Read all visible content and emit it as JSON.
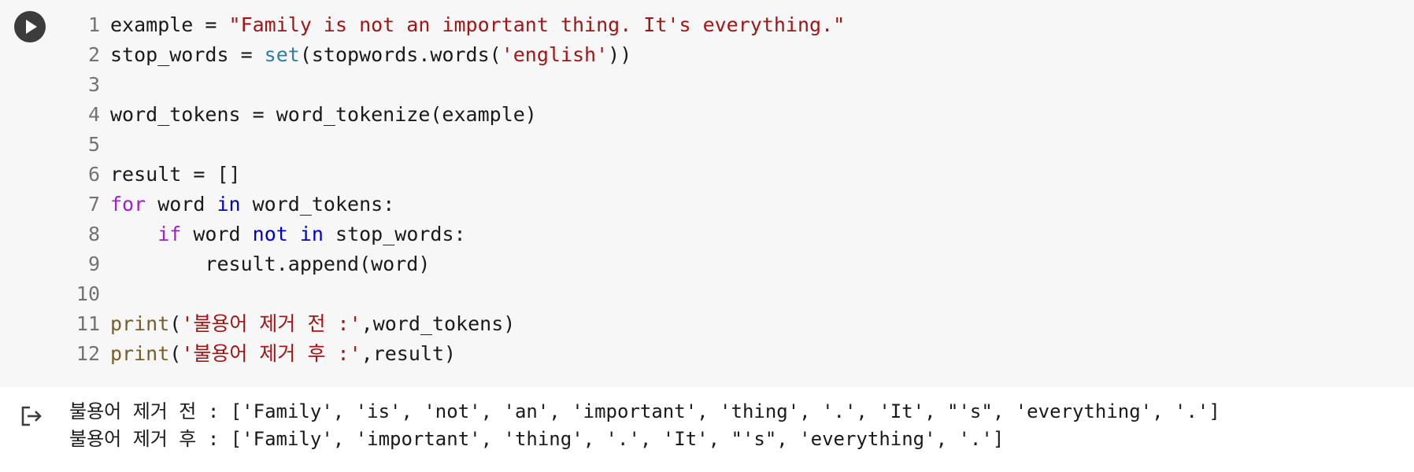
{
  "cell": {
    "run_icon": "play-icon",
    "output_icon": "output-redirect-icon",
    "lines": [
      {
        "n": "1",
        "tokens": [
          {
            "t": "example = ",
            "c": "plain"
          },
          {
            "t": "\"Family is not an important thing. It's everything.\"",
            "c": "str"
          }
        ]
      },
      {
        "n": "2",
        "tokens": [
          {
            "t": "stop_words = ",
            "c": "plain"
          },
          {
            "t": "set",
            "c": "bi"
          },
          {
            "t": "(stopwords.words(",
            "c": "plain"
          },
          {
            "t": "'english'",
            "c": "str"
          },
          {
            "t": "))",
            "c": "plain"
          }
        ]
      },
      {
        "n": "3",
        "tokens": []
      },
      {
        "n": "4",
        "tokens": [
          {
            "t": "word_tokens = word_tokenize(example)",
            "c": "plain"
          }
        ]
      },
      {
        "n": "5",
        "tokens": []
      },
      {
        "n": "6",
        "tokens": [
          {
            "t": "result = []",
            "c": "plain"
          }
        ]
      },
      {
        "n": "7",
        "tokens": [
          {
            "t": "for",
            "c": "kw"
          },
          {
            "t": " word ",
            "c": "plain"
          },
          {
            "t": "in",
            "c": "op"
          },
          {
            "t": " word_tokens:",
            "c": "plain"
          }
        ]
      },
      {
        "n": "8",
        "tokens": [
          {
            "t": "    ",
            "c": "plain"
          },
          {
            "t": "if",
            "c": "kw"
          },
          {
            "t": " word ",
            "c": "plain"
          },
          {
            "t": "not",
            "c": "op"
          },
          {
            "t": " ",
            "c": "plain"
          },
          {
            "t": "in",
            "c": "op"
          },
          {
            "t": " stop_words:",
            "c": "plain"
          }
        ]
      },
      {
        "n": "9",
        "tokens": [
          {
            "t": "        result.append(word)",
            "c": "plain"
          }
        ]
      },
      {
        "n": "10",
        "tokens": []
      },
      {
        "n": "11",
        "tokens": [
          {
            "t": "print",
            "c": "fn"
          },
          {
            "t": "(",
            "c": "plain"
          },
          {
            "t": "'불용어 제거 전 :'",
            "c": "str"
          },
          {
            "t": ",word_tokens)",
            "c": "plain"
          }
        ]
      },
      {
        "n": "12",
        "tokens": [
          {
            "t": "print",
            "c": "fn"
          },
          {
            "t": "(",
            "c": "plain"
          },
          {
            "t": "'불용어 제거 후 :'",
            "c": "str"
          },
          {
            "t": ",result)",
            "c": "plain"
          }
        ]
      }
    ],
    "output": [
      "불용어 제거 전 : ['Family', 'is', 'not', 'an', 'important', 'thing', '.', 'It', \"'s\", 'everything', '.']",
      "불용어 제거 후 : ['Family', 'important', 'thing', '.', 'It', \"'s\", 'everything', '.']"
    ]
  },
  "colors": {
    "keyword": "#a020d0",
    "operator": "#0000cc",
    "string": "#a31515",
    "builtin": "#2e7ea3",
    "function": "#795e26",
    "code_background": "#f7f7f7"
  }
}
